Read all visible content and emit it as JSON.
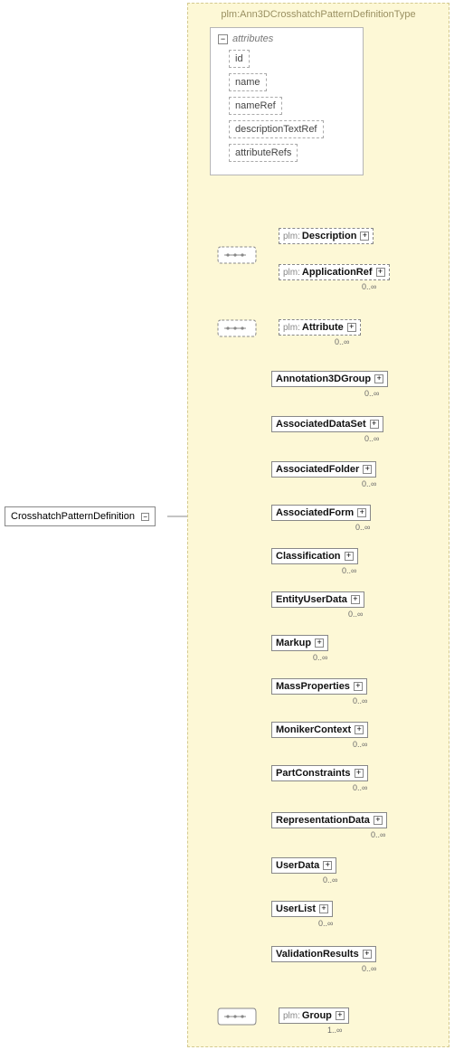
{
  "root": {
    "label": "CrosshatchPatternDefinition"
  },
  "type": {
    "title": "plm:Ann3DCrosshatchPatternDefinitionType"
  },
  "attributesPanel": {
    "heading": "attributes",
    "items": [
      {
        "label": "id"
      },
      {
        "label": "name"
      },
      {
        "label": "nameRef"
      },
      {
        "label": "descriptionTextRef"
      },
      {
        "label": "attributeRefs"
      }
    ]
  },
  "seq1": {
    "items": [
      {
        "prefix": "plm:",
        "label": "Description",
        "style": "dashed",
        "expand": true,
        "card": ""
      },
      {
        "prefix": "plm:",
        "label": "ApplicationRef",
        "style": "dashed",
        "expand": true,
        "card": "0..∞"
      }
    ]
  },
  "seq2": {
    "attribute": {
      "prefix": "plm:",
      "label": "Attribute",
      "style": "dashed",
      "expand": true,
      "card": "0..∞"
    },
    "substitutes": [
      {
        "label": "Annotation3DGroup",
        "card": "0..∞"
      },
      {
        "label": "AssociatedDataSet",
        "card": "0..∞"
      },
      {
        "label": "AssociatedFolder",
        "card": "0..∞"
      },
      {
        "label": "AssociatedForm",
        "card": "0..∞"
      },
      {
        "label": "Classification",
        "card": "0..∞"
      },
      {
        "label": "EntityUserData",
        "card": "0..∞"
      },
      {
        "label": "Markup",
        "card": "0..∞"
      },
      {
        "label": "MassProperties",
        "card": "0..∞"
      },
      {
        "label": "MonikerContext",
        "card": "0..∞"
      },
      {
        "label": "PartConstraints",
        "card": "0..∞"
      },
      {
        "label": "RepresentationData",
        "card": "0..∞"
      },
      {
        "label": "UserData",
        "card": "0..∞"
      },
      {
        "label": "UserList",
        "card": "0..∞"
      },
      {
        "label": "ValidationResults",
        "card": "0..∞"
      }
    ]
  },
  "seq3": {
    "group": {
      "prefix": "plm:",
      "label": "Group",
      "style": "solid",
      "expand": true,
      "card": "1..∞"
    }
  },
  "chart_data": {
    "type": "tree",
    "root": "CrosshatchPatternDefinition",
    "complexType": "plm:Ann3DCrosshatchPatternDefinitionType",
    "attributes": [
      "id",
      "name",
      "nameRef",
      "descriptionTextRef",
      "attributeRefs"
    ],
    "children": [
      {
        "kind": "sequence",
        "optional": true,
        "items": [
          {
            "name": "plm:Description",
            "min": 0,
            "max": 1
          },
          {
            "name": "plm:ApplicationRef",
            "min": 0,
            "max": "unbounded"
          }
        ]
      },
      {
        "kind": "sequence",
        "optional": true,
        "items": [
          {
            "name": "plm:Attribute",
            "min": 0,
            "max": "unbounded",
            "substitutionGroup": [
              "Annotation3DGroup",
              "AssociatedDataSet",
              "AssociatedFolder",
              "AssociatedForm",
              "Classification",
              "EntityUserData",
              "Markup",
              "MassProperties",
              "MonikerContext",
              "PartConstraints",
              "RepresentationData",
              "UserData",
              "UserList",
              "ValidationResults"
            ]
          }
        ]
      },
      {
        "kind": "sequence",
        "items": [
          {
            "name": "plm:Group",
            "min": 1,
            "max": "unbounded"
          }
        ]
      }
    ]
  }
}
